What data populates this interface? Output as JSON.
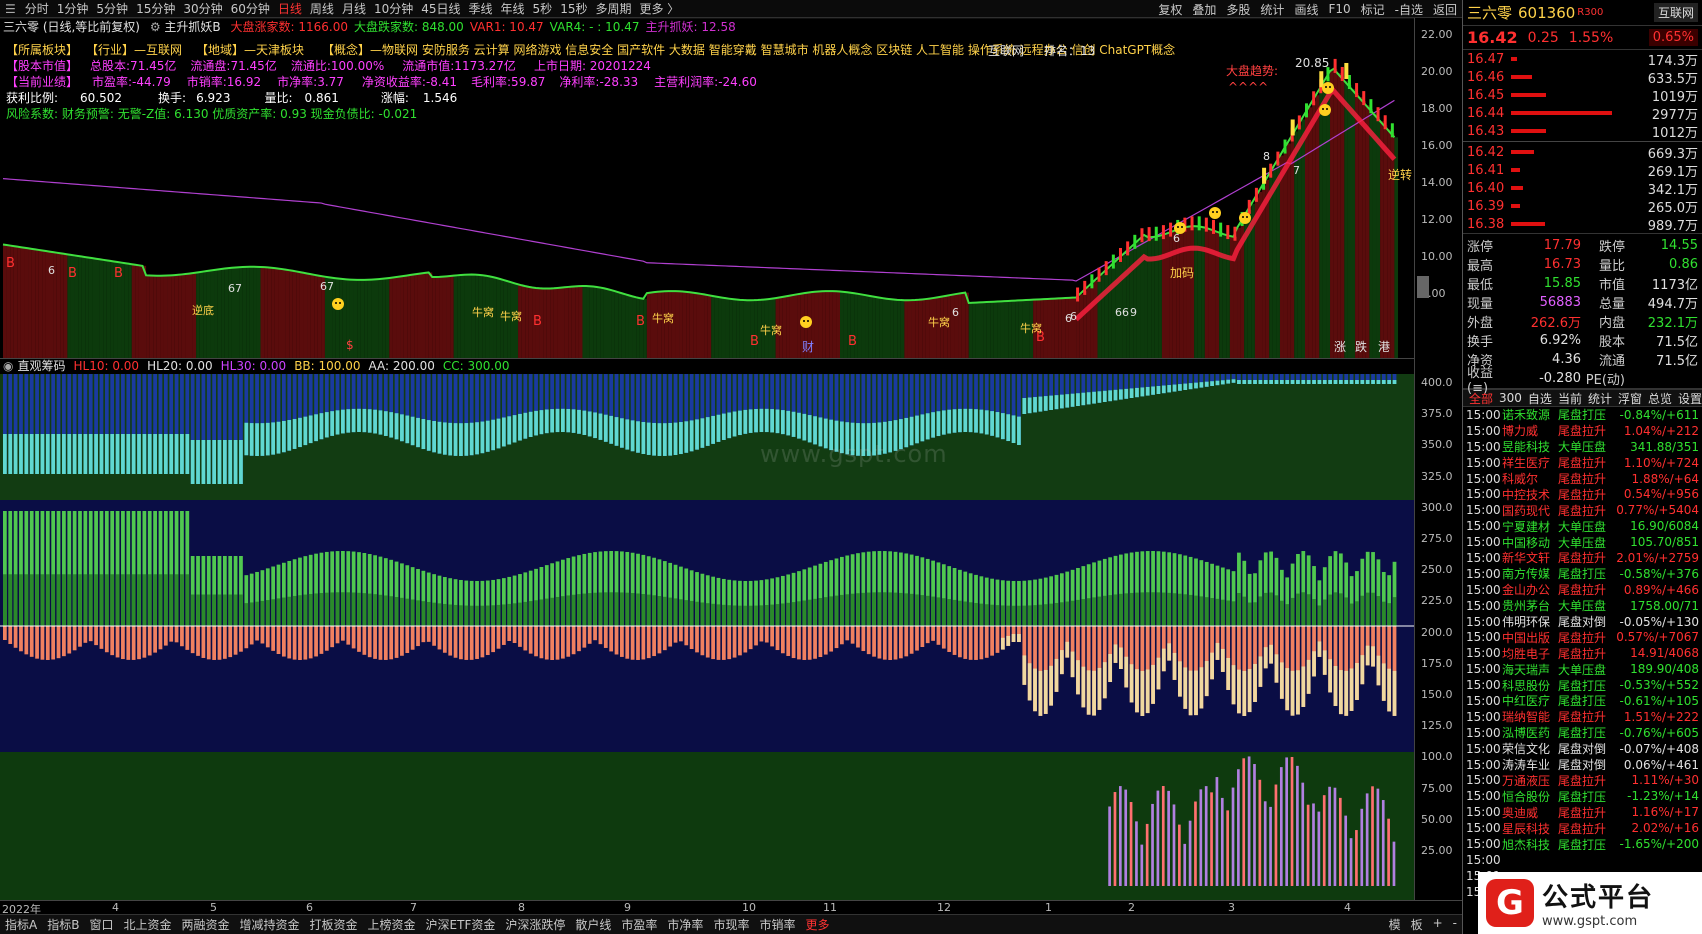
{
  "top_menu": {
    "icon": "menu-icon",
    "periods": [
      "分时",
      "1分钟",
      "5分钟",
      "15分钟",
      "30分钟",
      "60分钟",
      "日线",
      "周线",
      "月线",
      "10分钟",
      "45日线",
      "季线",
      "年线",
      "5秒",
      "15秒",
      "多周期",
      "更多 〉"
    ],
    "active_period": "日线",
    "right_items": [
      "复权",
      "叠加",
      "多股",
      "统计",
      "画线",
      "F10",
      "标记",
      "-自选",
      "返回"
    ]
  },
  "chart_header": {
    "title": "三六零 (日线,等比前复权)",
    "indicator_name": "主升抓妖B",
    "stats": [
      {
        "text": "大盘涨家数: 1166.00",
        "color": "#ff3030"
      },
      {
        "text": "大盘跌家数: 848.00",
        "color": "#30e030"
      },
      {
        "text": "VAR1: 10.47",
        "color": "#ff3030"
      },
      {
        "text": "VAR4: - : 10.47",
        "color": "#30e030"
      },
      {
        "text": "主升抓妖: 12.58",
        "color": "#d030d0"
      }
    ]
  },
  "info_panel": {
    "line1": [
      {
        "text": "【所属板块】",
        "color": "#ffd24a"
      },
      {
        "text": "【行业】—互联网",
        "color": "#ffd24a"
      },
      {
        "text": "【地域】—天津板块",
        "color": "#ffd24a"
      },
      {
        "text": "【概念】—物联网 安防服务 云计算 网络游戏 信息安全 国产软件 大数据 智能穿戴 智慧城市 机器人概念 区块链 人工智能 操作系统 远程办公 信创 ChatGPT概念",
        "color": "#ffd24a"
      }
    ],
    "line2": [
      {
        "text": "【股本市值】",
        "color": "#ff40ff"
      },
      {
        "text": "总股本:71.45亿",
        "color": "#ff40ff"
      },
      {
        "text": "流通盘:71.45亿",
        "color": "#ff40ff"
      },
      {
        "text": "流通比:100.00%",
        "color": "#ff40ff"
      },
      {
        "text": "流通市值:1173.27亿",
        "color": "#ff40ff"
      },
      {
        "text": "上市日期: 20201224",
        "color": "#ff40ff"
      }
    ],
    "line3": [
      {
        "text": "【当前业绩】",
        "color": "#ff40ff"
      },
      {
        "text": "市盈率:-44.79",
        "color": "#ff40ff"
      },
      {
        "text": "市销率:16.92",
        "color": "#ff40ff"
      },
      {
        "text": "市净率:3.77",
        "color": "#ff40ff"
      },
      {
        "text": "净资收益率:-8.41",
        "color": "#ff40ff"
      },
      {
        "text": "毛利率:59.87",
        "color": "#ff40ff"
      },
      {
        "text": "净利率:-28.33",
        "color": "#ff40ff"
      },
      {
        "text": "主营利润率:-24.60",
        "color": "#ff40ff"
      }
    ],
    "line4": [
      {
        "text": "获利比例:",
        "color": "#ffffff"
      },
      {
        "text": "60.502",
        "color": "#ffffff"
      },
      {
        "text": "换手:",
        "color": "#ffffff"
      },
      {
        "text": "6.923",
        "color": "#ffffff"
      },
      {
        "text": "量比:",
        "color": "#ffffff"
      },
      {
        "text": "0.861",
        "color": "#ffffff"
      },
      {
        "text": "涨幅:",
        "color": "#ffffff"
      },
      {
        "text": "1.546",
        "color": "#ffffff"
      }
    ],
    "line5": {
      "text": "风险系数: 财务预警: 无警-Z值: 6.130 优质资产率: 0.93 现金负债比: -0.021",
      "color": "#30e030"
    }
  },
  "chart_annotations": {
    "hulianwang": "互联网",
    "rank": "排名：13",
    "peak": "20.85",
    "trend": "大盘趋势:",
    "trend_marks": "^^^^",
    "jiama": "加码",
    "nizhuan": "逆转",
    "zhangdie": [
      "涨",
      "跌",
      "港"
    ],
    "cai": "财",
    "dollar": "$",
    "buy_mark": "B",
    "digit_labels": [
      "6",
      "7",
      "8",
      "6",
      "67",
      "67",
      "6",
      "6",
      "6",
      "66",
      "9"
    ],
    "chanlabels": [
      "逆底",
      "牛窝",
      "牛窝",
      "牛窝",
      "牛窝",
      "牛窝",
      "牛窝"
    ]
  },
  "chips": [
    {
      "text": "直观筹码",
      "color": "#e0e0e0"
    },
    {
      "text": "HL10: 0.00",
      "color": "#ff3030"
    },
    {
      "text": "HL20: 0.00",
      "color": "#e0e0e0"
    },
    {
      "text": "HL30: 0.00",
      "color": "#cc44ff"
    },
    {
      "text": "BB: 100.00",
      "color": "#ffd24a"
    },
    {
      "text": "AA: 200.00",
      "color": "#e0e0e0"
    },
    {
      "text": "CC: 300.00",
      "color": "#30e030"
    }
  ],
  "right_axis": {
    "price_ticks": [
      "22.00",
      "20.00",
      "18.00",
      "16.00",
      "14.00",
      "12.00",
      "10.00",
      "8.00"
    ],
    "lower_ticks": [
      "400.0",
      "375.0",
      "350.0",
      "325.0",
      "300.0",
      "275.0",
      "250.0",
      "225.0",
      "200.0",
      "175.0",
      "150.0",
      "125.0",
      "100.0",
      "75.00",
      "50.00",
      "25.00"
    ],
    "corner_label": "日线"
  },
  "date_axis": [
    "2022年",
    "4",
    "5",
    "6",
    "7",
    "8",
    "9",
    "10",
    "11",
    "12",
    "1",
    "2",
    "3",
    "4"
  ],
  "bottom_bar": {
    "items": [
      "指标A",
      "指标B",
      "窗口",
      "北上资金",
      "两融资金",
      "增减持资金",
      "打板资金",
      "上榜资金",
      "沪深ETF资金",
      "沪深涨跌停",
      "散户线",
      "市盈率",
      "市净率",
      "市现率",
      "市销率",
      "更多"
    ],
    "highlight": "更多",
    "right_items": [
      "模",
      "板",
      "+",
      "-"
    ]
  },
  "quote": {
    "name": "三六零",
    "code": "601360",
    "badge": "R",
    "badge2": "300",
    "sector": "互联网",
    "price": "16.42",
    "change": "0.25",
    "pct": "1.55%",
    "sector_pct": "0.65%",
    "asks": [
      {
        "price": "16.47",
        "vol": "174.3万",
        "bar": 0.06
      },
      {
        "price": "16.46",
        "vol": "633.5万",
        "bar": 0.2
      },
      {
        "price": "16.45",
        "vol": "1019万",
        "bar": 0.33
      },
      {
        "price": "16.44",
        "vol": "2977万",
        "bar": 0.96
      },
      {
        "price": "16.43",
        "vol": "1012万",
        "bar": 0.33
      }
    ],
    "bids": [
      {
        "price": "16.42",
        "vol": "669.3万",
        "bar": 0.22
      },
      {
        "price": "16.41",
        "vol": "269.1万",
        "bar": 0.09
      },
      {
        "price": "16.40",
        "vol": "342.1万",
        "bar": 0.11
      },
      {
        "price": "16.39",
        "vol": "265.0万",
        "bar": 0.09
      },
      {
        "price": "16.38",
        "vol": "989.7万",
        "bar": 0.32
      }
    ],
    "stats": [
      {
        "k": "涨停",
        "v": "17.79",
        "vc": "#ff3030",
        "k2": "跌停",
        "v2": "14.55",
        "v2c": "#30e030"
      },
      {
        "k": "最高",
        "v": "16.73",
        "vc": "#ff3030",
        "k2": "量比",
        "v2": "0.86",
        "v2c": "#30e030"
      },
      {
        "k": "最低",
        "v": "15.85",
        "vc": "#30e030",
        "k2": "市值",
        "v2": "1173亿",
        "v2c": "#e0e0e0"
      },
      {
        "k": "现量",
        "v": "56883",
        "vc": "#e060ff",
        "k2": "总量",
        "v2": "494.7万",
        "v2c": "#e0e0e0"
      },
      {
        "k": "外盘",
        "v": "262.6万",
        "vc": "#ff3030",
        "k2": "内盘",
        "v2": "232.1万",
        "v2c": "#30e030"
      },
      {
        "k": "换手",
        "v": "6.92%",
        "vc": "#e0e0e0",
        "k2": "股本",
        "v2": "71.5亿",
        "v2c": "#e0e0e0"
      },
      {
        "k": "净资",
        "v": "4.36",
        "vc": "#e0e0e0",
        "k2": "流通",
        "v2": "71.5亿",
        "v2c": "#e0e0e0"
      },
      {
        "k": "收益(≡)",
        "v": "-0.280",
        "vc": "#e0e0e0",
        "k2": "PE(动)",
        "v2": "",
        "v2c": "#e0e0e0"
      }
    ],
    "tabs": [
      "全部",
      "300",
      "自选",
      "当前",
      "统计",
      "浮窗",
      "总览",
      "设置"
    ],
    "active_tab": "全部"
  },
  "radar": [
    {
      "time": "15:00",
      "name": "诺禾致源",
      "event": "尾盘打压",
      "delta": "-0.84%/+611",
      "c": "#30e030"
    },
    {
      "time": "15:00",
      "name": "博力威",
      "event": "尾盘拉升",
      "delta": "1.04%/+212",
      "c": "#ff3030"
    },
    {
      "time": "15:00",
      "name": "昱能科技",
      "event": "大单压盘",
      "delta": "341.88/351",
      "c": "#30e030"
    },
    {
      "time": "15:00",
      "name": "祥生医疗",
      "event": "尾盘拉升",
      "delta": "1.10%/+724",
      "c": "#ff3030"
    },
    {
      "time": "15:00",
      "name": "科威尔",
      "event": "尾盘拉升",
      "delta": "1.88%/+64",
      "c": "#ff3030"
    },
    {
      "time": "15:00",
      "name": "中控技术",
      "event": "尾盘拉升",
      "delta": "0.54%/+956",
      "c": "#ff3030"
    },
    {
      "time": "15:00",
      "name": "国药现代",
      "event": "尾盘拉升",
      "delta": "0.77%/+5404",
      "c": "#ff3030"
    },
    {
      "time": "15:00",
      "name": "宁夏建材",
      "event": "大单压盘",
      "delta": "16.90/6084",
      "c": "#30e030"
    },
    {
      "time": "15:00",
      "name": "中国移动",
      "event": "大单压盘",
      "delta": "105.70/851",
      "c": "#30e030"
    },
    {
      "time": "15:00",
      "name": "新华文轩",
      "event": "尾盘拉升",
      "delta": "2.01%/+2759",
      "c": "#ff3030"
    },
    {
      "time": "15:00",
      "name": "南方传媒",
      "event": "尾盘打压",
      "delta": "-0.58%/+376",
      "c": "#30e030"
    },
    {
      "time": "15:00",
      "name": "金山办公",
      "event": "尾盘拉升",
      "delta": "0.89%/+466",
      "c": "#ff3030"
    },
    {
      "time": "15:00",
      "name": "贵州茅台",
      "event": "大单压盘",
      "delta": "1758.00/71",
      "c": "#30e030"
    },
    {
      "time": "15:00",
      "name": "伟明环保",
      "event": "尾盘对倒",
      "delta": "-0.05%/+130",
      "c": "#e0e0e0"
    },
    {
      "time": "15:00",
      "name": "中国出版",
      "event": "尾盘拉升",
      "delta": "0.57%/+7067",
      "c": "#ff3030"
    },
    {
      "time": "15:00",
      "name": "均胜电子",
      "event": "尾盘拉升",
      "delta": "14.91/4068",
      "c": "#ff3030"
    },
    {
      "time": "15:00",
      "name": "海天瑞声",
      "event": "大单压盘",
      "delta": "189.90/408",
      "c": "#30e030"
    },
    {
      "time": "15:00",
      "name": "科思股份",
      "event": "尾盘打压",
      "delta": "-0.53%/+552",
      "c": "#30e030"
    },
    {
      "time": "15:00",
      "name": "中红医疗",
      "event": "尾盘打压",
      "delta": "-0.61%/+105",
      "c": "#30e030"
    },
    {
      "time": "15:00",
      "name": "瑞纳智能",
      "event": "尾盘拉升",
      "delta": "1.51%/+222",
      "c": "#ff3030"
    },
    {
      "time": "15:00",
      "name": "泓博医药",
      "event": "尾盘打压",
      "delta": "-0.76%/+605",
      "c": "#30e030"
    },
    {
      "time": "15:00",
      "name": "荣信文化",
      "event": "尾盘对倒",
      "delta": "-0.07%/+408",
      "c": "#e0e0e0"
    },
    {
      "time": "15:00",
      "name": "涛涛车业",
      "event": "尾盘对倒",
      "delta": "0.06%/+461",
      "c": "#e0e0e0"
    },
    {
      "time": "15:00",
      "name": "万通液压",
      "event": "尾盘拉升",
      "delta": "1.11%/+30",
      "c": "#ff3030"
    },
    {
      "time": "15:00",
      "name": "恒合股份",
      "event": "尾盘打压",
      "delta": "-1.23%/+14",
      "c": "#30e030"
    },
    {
      "time": "15:00",
      "name": "奥迪威",
      "event": "尾盘拉升",
      "delta": "1.16%/+17",
      "c": "#ff3030"
    },
    {
      "time": "15:00",
      "name": "星辰科技",
      "event": "尾盘拉升",
      "delta": "2.02%/+16",
      "c": "#ff3030"
    },
    {
      "time": "15:00",
      "name": "旭杰科技",
      "event": "尾盘打压",
      "delta": "-1.65%/+200",
      "c": "#30e030"
    },
    {
      "time": "15:00",
      "name": "",
      "event": "",
      "delta": "",
      "c": "#ff3030"
    },
    {
      "time": "15:01",
      "name": "",
      "event": "",
      "delta": "",
      "c": "#e0e0e0"
    },
    {
      "time": "15:01",
      "name": "",
      "event": "",
      "delta": "",
      "c": "#e0e0e0"
    }
  ],
  "watermark": "www.gspt.com",
  "logo": {
    "mark": "G",
    "title": "公式平台",
    "url": "www.gspt.com"
  },
  "colors": {
    "up": "#ff3030",
    "down": "#30e030",
    "lower_bg": "#0a0d45",
    "panel_green": "#103a10"
  }
}
